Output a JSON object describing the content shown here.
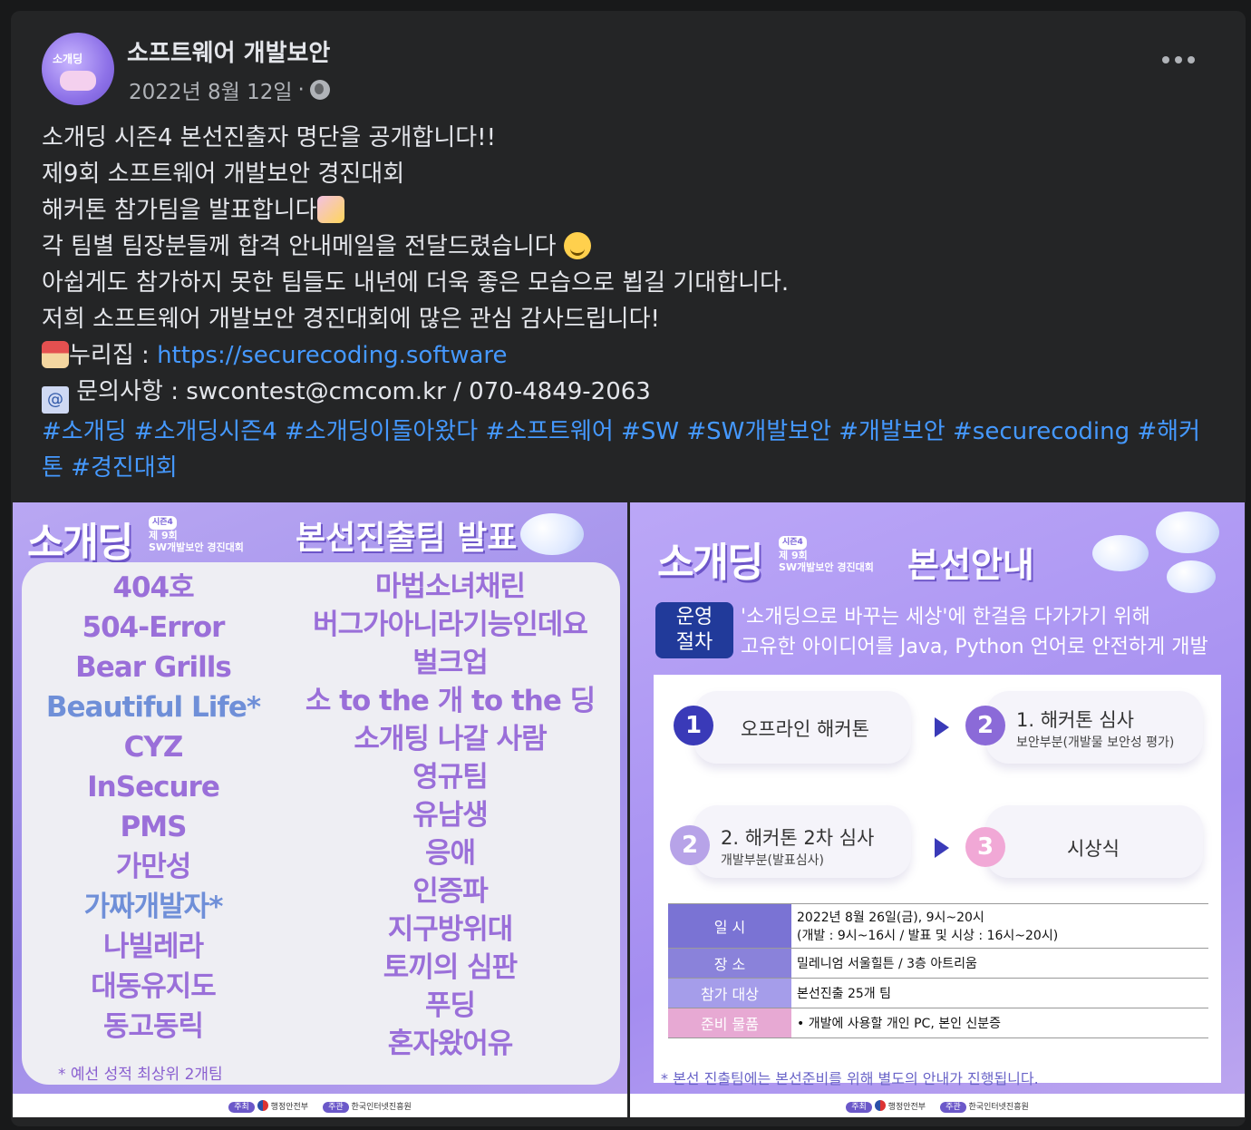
{
  "post": {
    "page_name": "소프트웨어 개발보안",
    "date": "2022년 8월 12일",
    "separator": "·",
    "avatar_text": "소개딩",
    "more_icon": "more-horizontal-icon",
    "privacy_icon": "globe-icon",
    "lines": [
      "소개딩 시즌4 본선진출자 명단을 공개합니다!!",
      "제9회 소프트웨어 개발보안 경진대회",
      "해커톤 참가팀을 발표합니다",
      "각 팀별 팀장분들께 합격 안내메일을 전달드렸습니다",
      "아쉽게도 참가하지 못한 팀들도 내년에 더욱 좋은 모습으로 뵙길 기대합니다.",
      "저희 소프트웨어 개발보안 경진대회에 많은 관심 감사드립니다!"
    ],
    "homepage_label": "누리집 : ",
    "homepage_url": "https://securecoding.software",
    "contact_text": " 문의사항 : swcontest@cmcom.kr / 070-4849-2063",
    "hashtags": "#소개딩 #소개딩시즌4 #소개딩이돌아왔다 #소프트웨어 #SW #SW개발보안 #개발보안 #securecoding #해커톤 #경진대회",
    "link_color": "#4599ff"
  },
  "image_left": {
    "logo": "소개딩",
    "season": "시즌4",
    "edition": "제 9회",
    "contest": "SW개발보안 경진대회",
    "title": "본선진출팀 발표",
    "teams_left": [
      "404호",
      "504-Error",
      "Bear Grills",
      "Beautiful Life*",
      "CYZ",
      "InSecure",
      "PMS",
      "가만성",
      "가짜개발자*",
      "나빌레라",
      "대동유지도",
      "동고동릭"
    ],
    "teams_right": [
      "마법소녀채린",
      "버그가아니라기능인데요",
      "벌크업",
      "소 to the 개 to the 딩",
      "소개팅 나갈 사람",
      "영규팀",
      "유남생",
      "응애",
      "인증파",
      "지구방위대",
      "토끼의 심판",
      "푸딩",
      "혼자왔어유"
    ],
    "note": "* 예선 성적 최상위 2개팀",
    "host_label": "주최",
    "host": "행정안전부",
    "organizer_label": "주관",
    "organizer": "한국인터넷진흥원"
  },
  "image_right": {
    "logo": "소개딩",
    "season": "시즌4",
    "edition": "제 9회",
    "contest": "SW개발보안 경진대회",
    "title": "본선안내",
    "op_label_1": "운영",
    "op_label_2": "절차",
    "op_line_1": "'소개딩으로 바꾸는 세상'에 한걸음 다가가기 위해",
    "op_line_2": "고유한 아이디어를 Java, Python 언어로 안전하게 개발",
    "steps": [
      {
        "num": "1",
        "title": "오프라인 해커톤",
        "sub": ""
      },
      {
        "num": "2",
        "title": "1. 해커톤 심사",
        "sub": "보안부분(개발물 보안성 평가)"
      },
      {
        "num": "2",
        "title": "2. 해커톤 2차 심사",
        "sub": "개발부분(발표심사)"
      },
      {
        "num": "3",
        "title": "시상식",
        "sub": ""
      }
    ],
    "table": [
      {
        "key": "일  시",
        "value": "2022년 8월 26일(금), 9시~20시",
        "value2": "(개발 : 9시~16시 / 발표 및 시상 : 16시~20시)"
      },
      {
        "key": "장  소",
        "value": "밀레니엄 서울힐튼 / 3층 아트리움",
        "value2": ""
      },
      {
        "key": "참가 대상",
        "value": "본선진출 25개 팀",
        "value2": ""
      },
      {
        "key": "준비 물품",
        "value": "• 개발에 사용할 개인 PC, 본인 신분증",
        "value2": ""
      }
    ],
    "note": "* 본선 진출팀에는 본선준비를 위해 별도의 안내가 진행됩니다.",
    "host_label": "주최",
    "host": "행정안전부",
    "organizer_label": "주관",
    "organizer": "한국인터넷진흥원"
  }
}
